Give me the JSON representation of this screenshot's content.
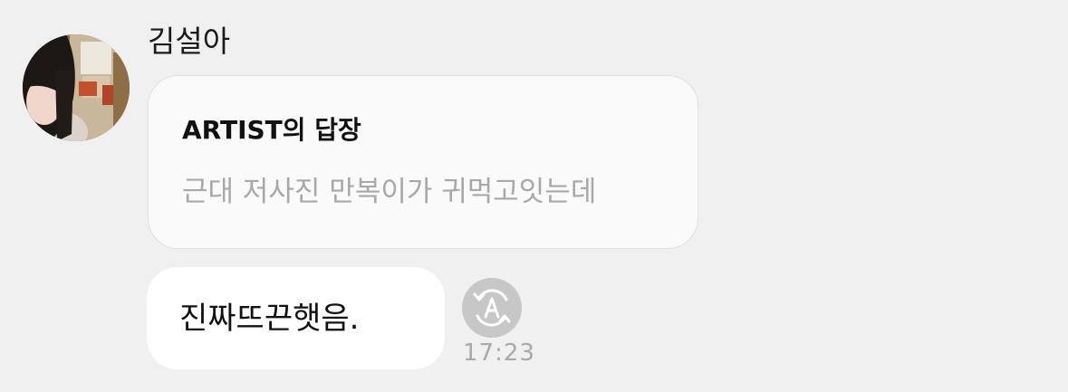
{
  "sender": {
    "name": "김설아",
    "avatar_icon": "profile-photo"
  },
  "reply": {
    "label": "ARTIST의 답장",
    "quoted_text": "근대 저사진 만복이가 귀먹고잇는데"
  },
  "message": {
    "text": "진짜뜨끈햇음.",
    "time": "17:23",
    "translate_icon": "auto-translate-icon"
  },
  "colors": {
    "background": "#f0f0f0",
    "bubble": "#ffffff",
    "reply_card": "#fafafa",
    "quoted_text": "#a8a8a8",
    "timestamp": "#a9a9a9",
    "translate_button": "#c7c7c7"
  }
}
